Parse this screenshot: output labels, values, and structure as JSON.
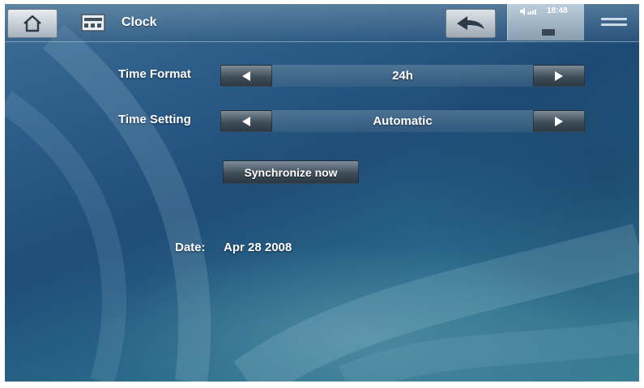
{
  "header": {
    "title": "Clock",
    "home_icon": "home-icon",
    "app_icon": "clock-app-icon",
    "back_icon": "back-arrow-icon",
    "menu_icon": "menu-icon"
  },
  "status": {
    "time": "18:48",
    "volume_icon": "volume-icon",
    "battery_icon": "battery-icon"
  },
  "settings": {
    "time_format": {
      "label": "Time Format",
      "value": "24h"
    },
    "time_setting": {
      "label": "Time Setting",
      "value": "Automatic"
    },
    "sync_button": "Synchronize now"
  },
  "date": {
    "label": "Date:",
    "value": "Apr 28 2008"
  },
  "colors": {
    "background": "#2a5b86",
    "button_dark": "#3f4e5a",
    "text": "#ffffff"
  }
}
